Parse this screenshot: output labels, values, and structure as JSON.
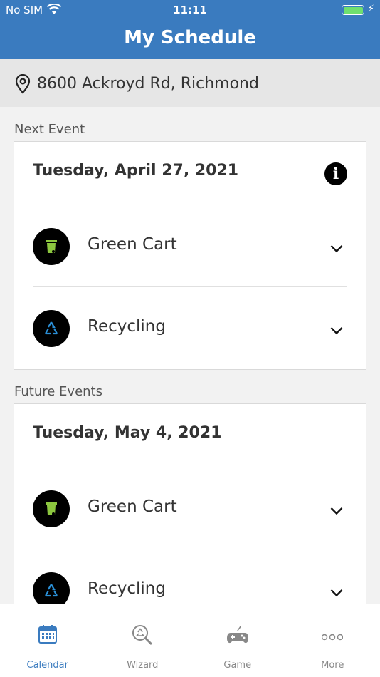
{
  "status_bar": {
    "carrier": "No SIM",
    "time": "11:11",
    "battery_level": 1.0
  },
  "header": {
    "title": "My Schedule"
  },
  "address": {
    "text": "8600 Ackroyd Rd, Richmond"
  },
  "next_event": {
    "label": "Next Event",
    "date": "Tuesday, April 27, 2021",
    "items": [
      {
        "name": "Green Cart",
        "icon": "green-cart-icon"
      },
      {
        "name": "Recycling",
        "icon": "recycling-icon"
      }
    ]
  },
  "future_events": {
    "label": "Future Events",
    "date": "Tuesday, May 4, 2021",
    "items": [
      {
        "name": "Green Cart",
        "icon": "green-cart-icon"
      },
      {
        "name": "Recycling",
        "icon": "recycling-icon"
      }
    ]
  },
  "tabs": [
    {
      "label": "Calendar",
      "icon": "calendar-icon",
      "active": true
    },
    {
      "label": "Wizard",
      "icon": "wizard-search-icon",
      "active": false
    },
    {
      "label": "Game",
      "icon": "game-controller-icon",
      "active": false
    },
    {
      "label": "More",
      "icon": "more-dots-icon",
      "active": false
    }
  ],
  "colors": {
    "brand": "#3a7bbf",
    "green_cart": "#8cc63f",
    "recycling": "#2a8fd6",
    "tab_inactive": "#888888"
  }
}
